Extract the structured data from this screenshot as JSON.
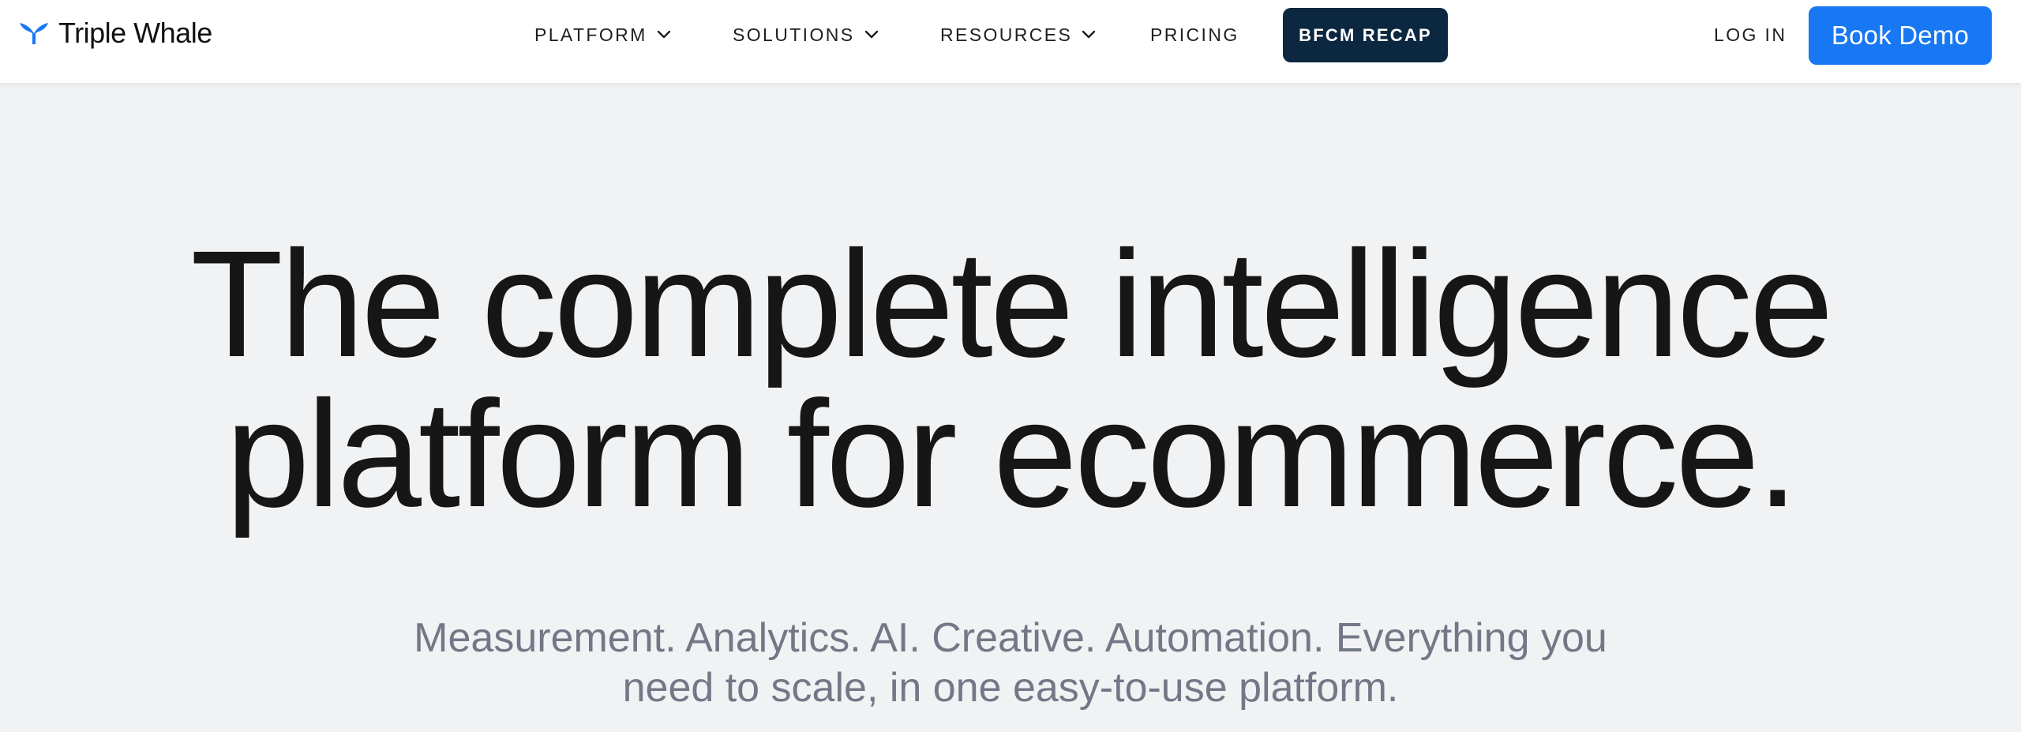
{
  "brand": {
    "name": "Triple Whale",
    "icon": "whale-tail-logo-icon",
    "logo_color": "#1877f2"
  },
  "nav": {
    "items": [
      {
        "label": "PLATFORM",
        "has_dropdown": true,
        "icon": "chevron-down-icon"
      },
      {
        "label": "SOLUTIONS",
        "has_dropdown": true,
        "icon": "chevron-down-icon"
      },
      {
        "label": "RESOURCES",
        "has_dropdown": true,
        "icon": "chevron-down-icon"
      },
      {
        "label": "PRICING",
        "has_dropdown": false
      }
    ],
    "bfcm_label": "BFCM RECAP",
    "bfcm_color": "#0c2740",
    "login_label": "LOG IN",
    "demo_label": "Book Demo",
    "demo_color": "#1877f2"
  },
  "hero": {
    "title_line1": "The complete intelligence",
    "title_line2": "platform for ecommerce.",
    "subtitle_line1": "Measurement. Analytics. AI. Creative. Automation. Everything you",
    "subtitle_line2": "need to scale, in one easy-to-use platform.",
    "background": "#f1f2f4"
  }
}
